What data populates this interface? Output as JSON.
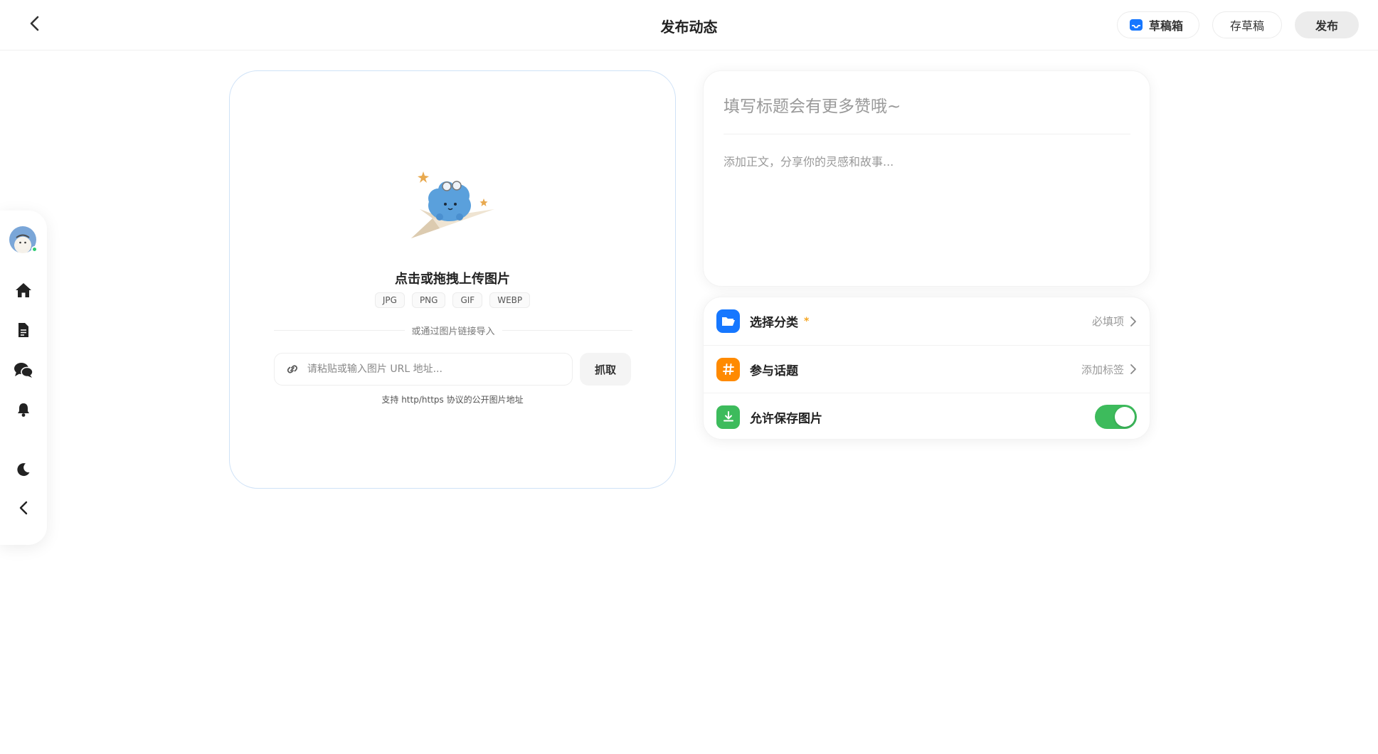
{
  "header": {
    "title": "发布动态",
    "drafts_label": "草稿箱",
    "save_draft_label": "存草稿",
    "publish_label": "发布"
  },
  "sidebar": {
    "items": [
      {
        "name": "home",
        "icon": "home-icon"
      },
      {
        "name": "document",
        "icon": "document-icon"
      },
      {
        "name": "messages",
        "icon": "chat-icon"
      },
      {
        "name": "notifications",
        "icon": "bell-icon"
      },
      {
        "name": "theme",
        "icon": "moon-icon"
      },
      {
        "name": "collapse",
        "icon": "chevron-left-icon"
      }
    ]
  },
  "upload": {
    "title": "点击或拖拽上传图片",
    "formats": [
      "JPG",
      "PNG",
      "GIF",
      "WEBP"
    ],
    "divider_text": "或通过图片链接导入",
    "url_placeholder": "请粘贴或输入图片 URL 地址...",
    "fetch_label": "抓取",
    "hint": "支持 http/https 协议的公开图片地址"
  },
  "editor": {
    "title_placeholder": "填写标题会有更多赞哦~",
    "body_placeholder": "添加正文，分享你的灵感和故事..."
  },
  "options": {
    "category": {
      "label": "选择分类",
      "required_mark": "*",
      "value": "必填项",
      "color": "#1677ff"
    },
    "topic": {
      "label": "参与话题",
      "value": "添加标签",
      "color": "#ff8a00"
    },
    "save_image": {
      "label": "允许保存图片",
      "enabled": true,
      "color": "#3dbb5c"
    }
  },
  "colors": {
    "accent_blue": "#1677ff",
    "toggle_on": "#3dbb5c",
    "upload_border": "#cfe2f7"
  }
}
